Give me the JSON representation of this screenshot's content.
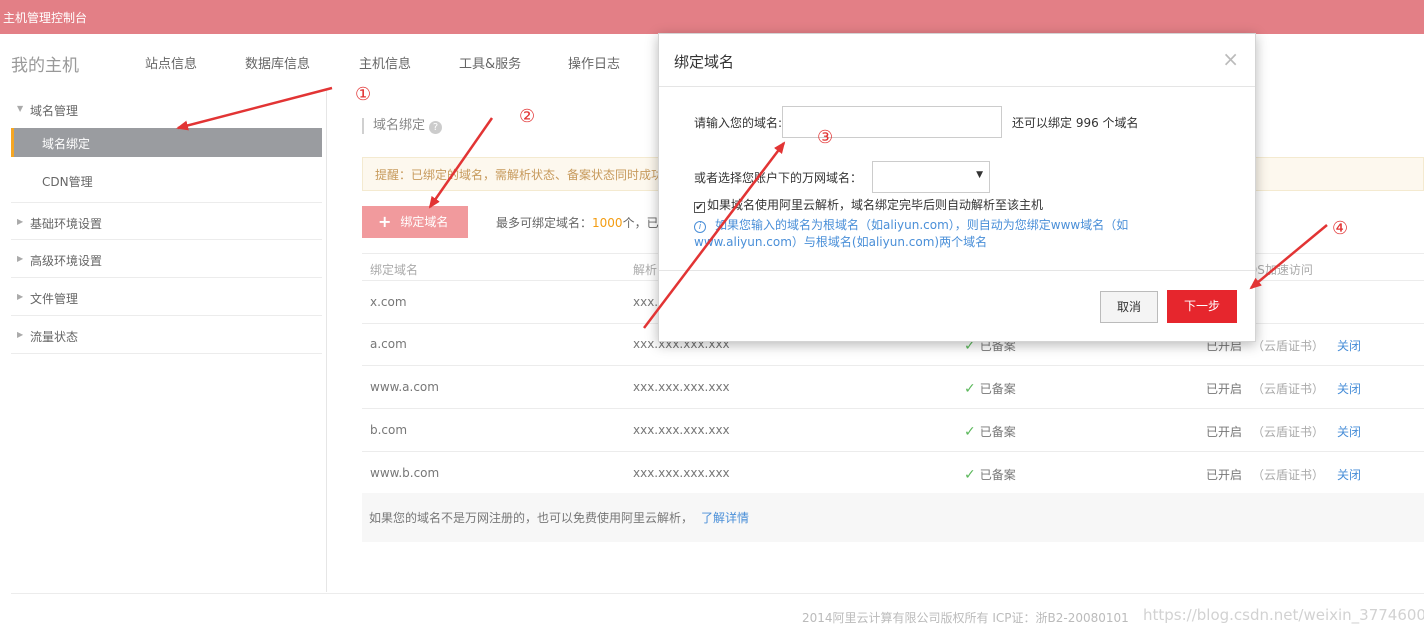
{
  "topbar": {
    "title": "主机管理控制台"
  },
  "navbar": {
    "brand": "我的主机",
    "items": [
      "站点信息",
      "数据库信息",
      "主机信息",
      "工具&服务",
      "操作日志"
    ]
  },
  "sidebar": {
    "groups": [
      {
        "label": "域名管理",
        "expanded": true
      },
      {
        "label": "基础环境设置"
      },
      {
        "label": "高级环境设置"
      },
      {
        "label": "文件管理"
      },
      {
        "label": "流量状态"
      }
    ],
    "active_item": "域名绑定",
    "sub_item": "CDN管理"
  },
  "main": {
    "breadcrumb": "域名绑定",
    "help_glyph": "?",
    "notice": "提醒：已绑定的域名，需解析状态、备案状态同时成功后才能访问",
    "bind_button": {
      "icon": "plus-icon",
      "glyph": "+",
      "label": "绑定域名"
    },
    "limit_prefix": "最多可绑定域名：",
    "limit_count": "1000",
    "limit_suffix": "个，已",
    "table": {
      "headers": [
        "绑定域名",
        "解析",
        "DS加速访问"
      ],
      "rows": [
        {
          "domain": "x.com",
          "ip": "xxx.",
          "icp": "",
          "https": "",
          "cert": "",
          "action": ""
        },
        {
          "domain": "a.com",
          "ip": "xxx.xxx.xxx.xxx",
          "icp": "已备案",
          "https": "已开启",
          "cert": "（云盾证书）",
          "action": "关闭"
        },
        {
          "domain": "www.a.com",
          "ip": "xxx.xxx.xxx.xxx",
          "icp": "已备案",
          "https": "已开启",
          "cert": "（云盾证书）",
          "action": "关闭"
        },
        {
          "domain": "b.com",
          "ip": "xxx.xxx.xxx.xxx",
          "icp": "已备案",
          "https": "已开启",
          "cert": "（云盾证书）",
          "action": "关闭"
        },
        {
          "domain": "www.b.com",
          "ip": "xxx.xxx.xxx.xxx",
          "icp": "已备案",
          "https": "已开启",
          "cert": "（云盾证书）",
          "action": "关闭"
        }
      ]
    },
    "footer_note": "如果您的域名不是万网注册的，也可以免费使用阿里云解析，",
    "footer_link": "了解详情"
  },
  "footer": {
    "copyright": "2014阿里云计算有限公司版权所有 ICP证：浙B2-20080101",
    "watermark": "https://blog.csdn.net/weixin_37746009"
  },
  "modal": {
    "title": "绑定域名",
    "close_glyph": "×",
    "domain_label": "请输入您的域名:",
    "domain_value": "",
    "remaining": "还可以绑定 996 个域名",
    "select_label": "或者选择您账户下的万网域名：",
    "select_value": "",
    "select_caret": "▼",
    "checkbox_checked": true,
    "checkbox_glyph": "✔",
    "checkbox_label": "如果域名使用阿里云解析，域名绑定完毕后则自动解析至该主机",
    "info_glyph": "i",
    "info_text": "如果您输入的域名为根域名（如aliyun.com），则自动为您绑定www域名（如www.aliyun.com）与根域名(如aliyun.com)两个域名",
    "cancel_label": "取消",
    "next_label": "下一步"
  },
  "annotations": {
    "markers": [
      "①",
      "②",
      "③",
      "④"
    ],
    "arrow_color": "#e23434"
  }
}
